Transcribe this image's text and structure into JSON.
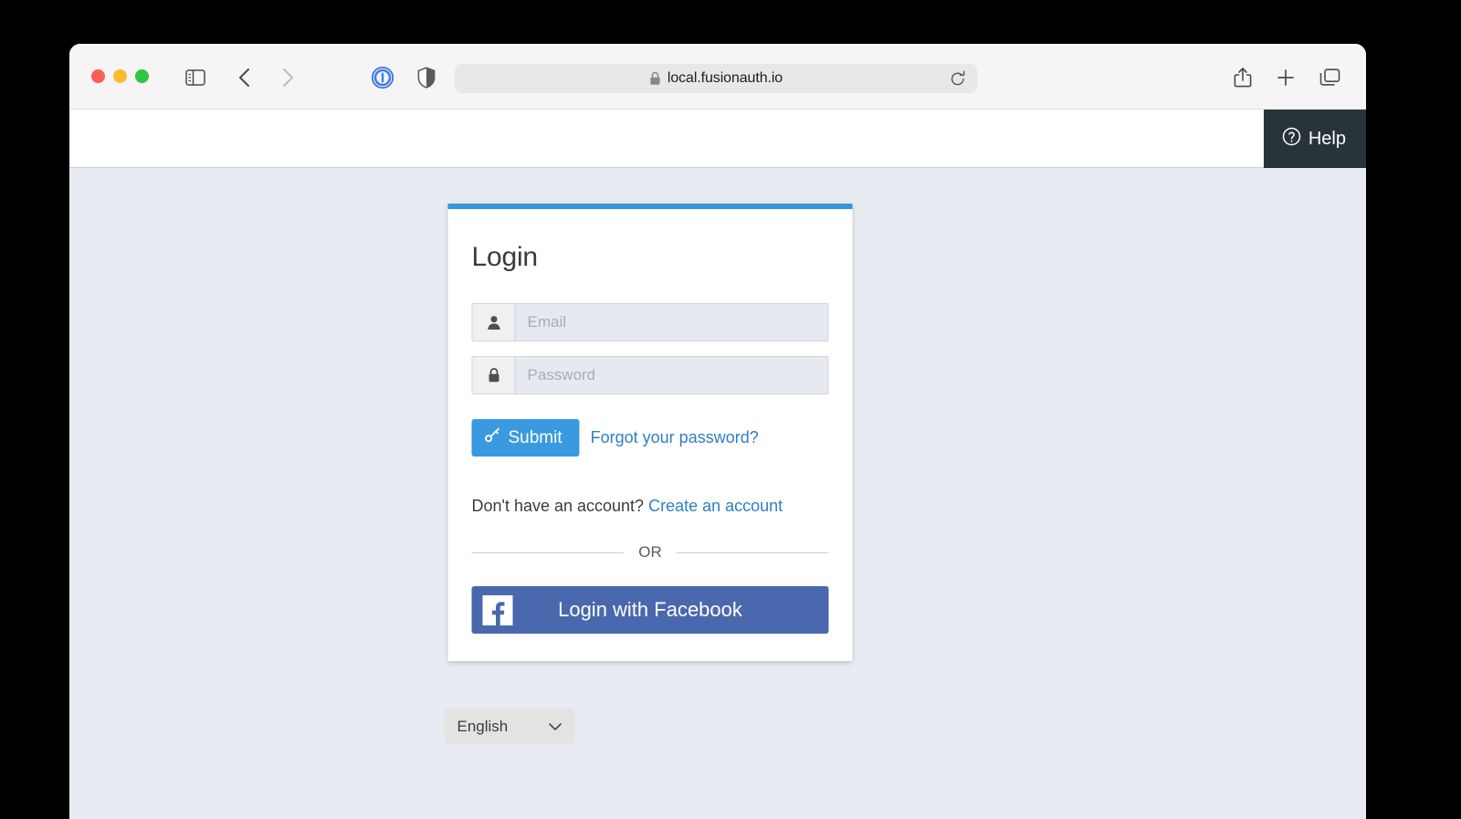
{
  "browser": {
    "url": "local.fusionauth.io",
    "toolbar_icons": {
      "sidebar": "sidebar-toggle-icon",
      "back": "back-arrow-icon",
      "forward": "forward-arrow-icon",
      "onepassword": "onepassword-icon",
      "shield": "shield-privacy-icon",
      "lock": "lock-icon",
      "reload": "reload-icon",
      "share": "share-icon",
      "newtab": "plus-icon",
      "tabs": "tab-overview-icon"
    },
    "traffic_lights": {
      "close": "#fc5f57",
      "minimize": "#fdbc2e",
      "maximize": "#2bc840"
    }
  },
  "page_header": {
    "help_label": "Help",
    "help_icon": "question-circle-icon",
    "help_bg": "#28343a"
  },
  "login": {
    "title": "Login",
    "accent_color": "#3a95d6",
    "fields": [
      {
        "name": "email",
        "icon": "user-icon",
        "placeholder": "Email",
        "value": ""
      },
      {
        "name": "password",
        "icon": "lock-icon",
        "placeholder": "Password",
        "value": ""
      }
    ],
    "submit_label": "Submit",
    "submit_icon": "key-icon",
    "submit_color": "#3a9ae0",
    "forgot_password_label": "Forgot your password?",
    "no_account_text": "Don't have an account?",
    "create_account_label": "Create an account",
    "link_color": "#2f7fc4",
    "or_label": "OR",
    "facebook_label": "Login with Facebook",
    "facebook_icon": "facebook-icon",
    "facebook_color": "#4a68ad"
  },
  "language": {
    "selected": "English",
    "caret_icon": "chevron-down-icon"
  }
}
